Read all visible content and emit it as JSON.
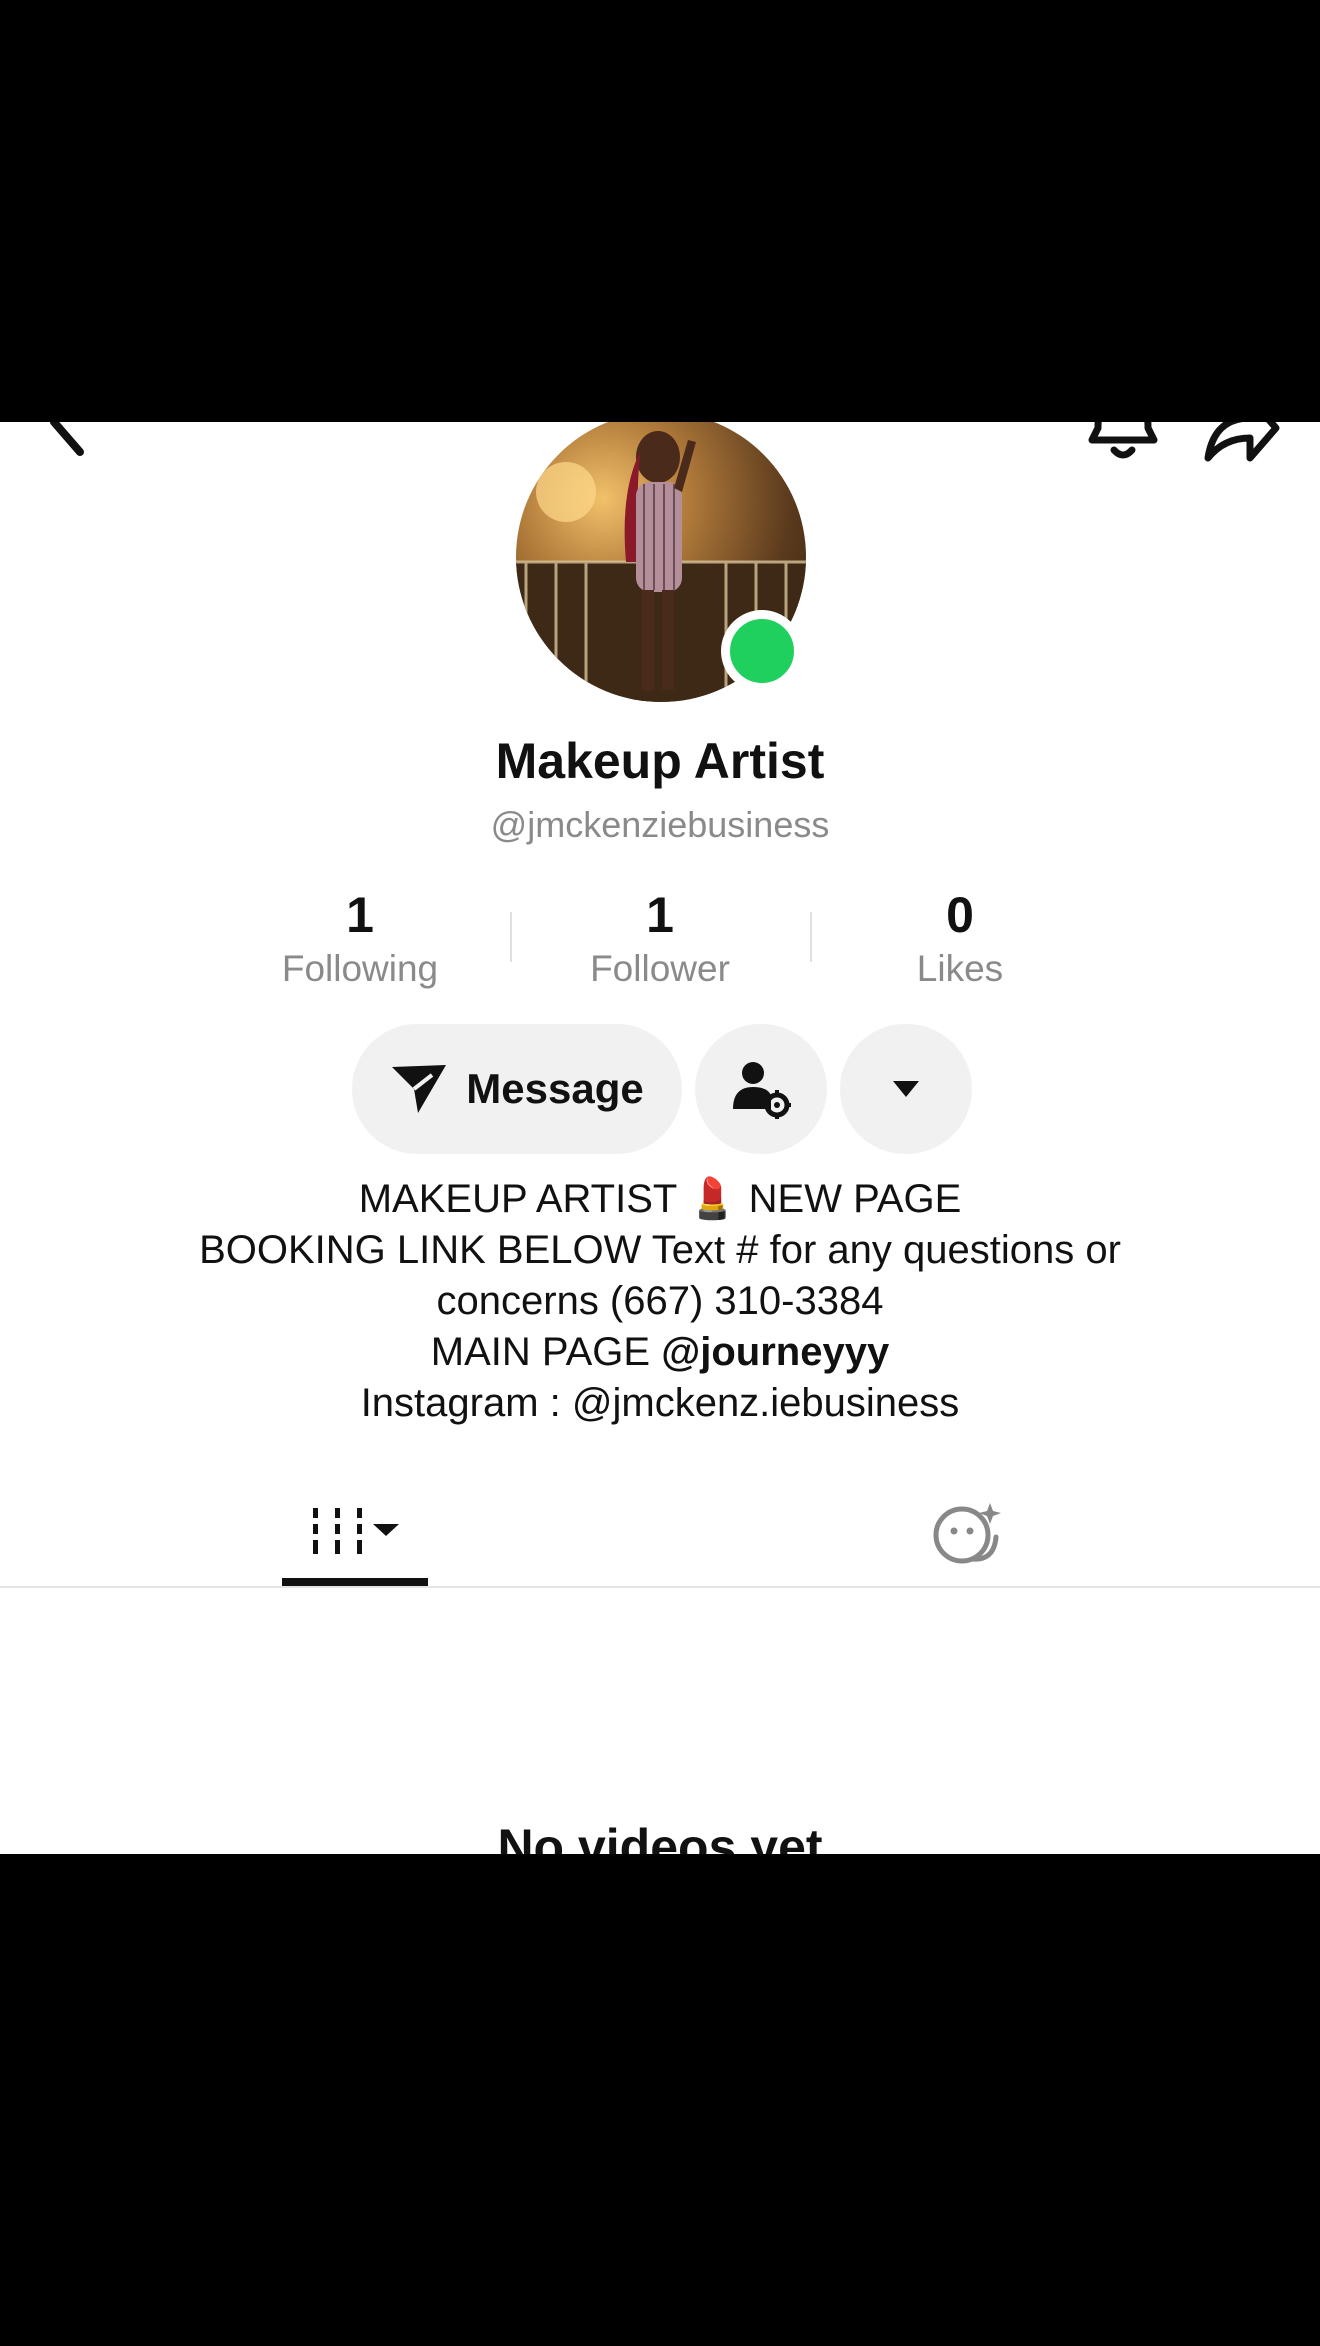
{
  "profile": {
    "display_name": "Makeup Artist",
    "username": "@jmckenziebusiness",
    "online": true
  },
  "stats": [
    {
      "value": "1",
      "label": "Following"
    },
    {
      "value": "1",
      "label": "Follower"
    },
    {
      "value": "0",
      "label": "Likes"
    }
  ],
  "actions": {
    "message_label": "Message"
  },
  "bio": {
    "line1": "MAKEUP ARTIST 💄 NEW PAGE",
    "line2": "BOOKING LINK BELOW Text # for any questions or",
    "line3": "concerns  (667) 310-3384",
    "line4_prefix": "MAIN PAGE ",
    "line4_mention": "@journeyyy",
    "line5": "Instagram : @jmckenz.iebusiness"
  },
  "empty_state": {
    "message": "No videos yet"
  },
  "colors": {
    "online_dot": "#20d05f",
    "button_bg": "#f1f1f2",
    "secondary_text": "#8a8a8a"
  },
  "icons": [
    "back-icon",
    "bell-icon",
    "share-icon",
    "send-icon",
    "friends-settings-icon",
    "caret-down-icon",
    "videos-grid-icon",
    "liked-icon"
  ]
}
